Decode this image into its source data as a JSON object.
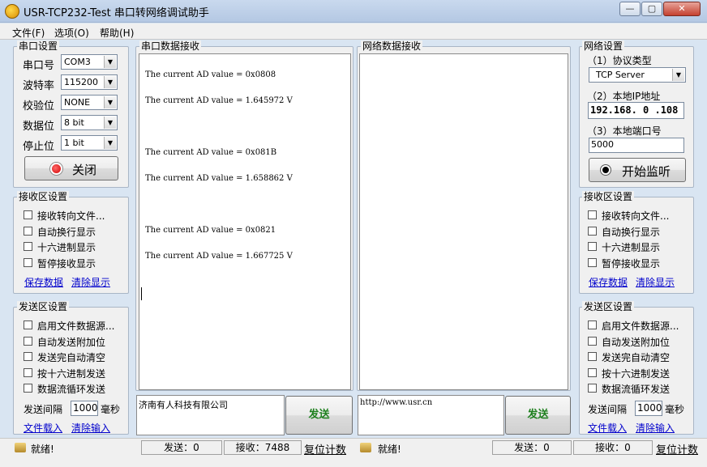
{
  "window": {
    "title": "USR-TCP232-Test 串口转网络调试助手",
    "minimize": "—",
    "maximize": "▢",
    "close": "✕"
  },
  "menu": [
    "文件(F)",
    "选项(O)",
    "帮助(H)"
  ],
  "serial_settings": {
    "title": "串口设置",
    "port_label": "串口号",
    "port_value": "COM3",
    "baud_label": "波特率",
    "baud_value": "115200",
    "parity_label": "校验位",
    "parity_value": "NONE",
    "databits_label": "数据位",
    "databits_value": "8 bit",
    "stopbits_label": "停止位",
    "stopbits_value": "1 bit",
    "close_button": "关闭"
  },
  "left_receive": {
    "title": "接收区设置",
    "options": [
      "接收转向文件...",
      "自动换行显示",
      "十六进制显示",
      "暂停接收显示"
    ],
    "save_link": "保存数据",
    "clear_link": "清除显示"
  },
  "left_send": {
    "title": "发送区设置",
    "options": [
      "启用文件数据源...",
      "自动发送附加位",
      "发送完自动清空",
      "按十六进制发送",
      "数据流循环发送"
    ],
    "interval_label": "发送间隔",
    "interval_value": "1000",
    "interval_unit": "毫秒",
    "load_link": "文件载入",
    "clear_link": "清除输入"
  },
  "serial_receive": {
    "title": "串口数据接收",
    "lines": [
      "The current AD value = 0x0808",
      "The current AD value = 1.645972 V",
      "The current AD value = 0x081B",
      "The current AD value = 1.658862 V",
      "The current AD value = 0x0821",
      "The current AD value = 1.667725 V"
    ]
  },
  "network_receive": {
    "title": "网络数据接收"
  },
  "serial_send": {
    "text": "济南有人科技有限公司",
    "button": "发送"
  },
  "network_send": {
    "text": "http://www.usr.cn",
    "button": "发送"
  },
  "network_settings": {
    "title": "网络设置",
    "protocol_label": "（1）协议类型",
    "protocol_value": "TCP Server",
    "ip_label": "（2）本地IP地址",
    "ip_value": "192.168. 0 .108",
    "port_label": "（3）本地端口号",
    "port_value": "5000",
    "listen_button": "开始监听"
  },
  "right_receive": {
    "title": "接收区设置",
    "options": [
      "接收转向文件...",
      "自动换行显示",
      "十六进制显示",
      "暂停接收显示"
    ],
    "save_link": "保存数据",
    "clear_link": "清除显示"
  },
  "right_send": {
    "title": "发送区设置",
    "options": [
      "启用文件数据源...",
      "自动发送附加位",
      "发送完自动清空",
      "按十六进制发送",
      "数据流循环发送"
    ],
    "interval_label": "发送间隔",
    "interval_value": "1000",
    "interval_unit": "毫秒",
    "load_link": "文件载入",
    "clear_link": "清除输入"
  },
  "status_left": {
    "ready": "就绪!",
    "sent": "发送：0",
    "received": "接收：7488",
    "reset": "复位计数"
  },
  "status_right": {
    "ready": "就绪!",
    "sent": "发送：0",
    "received": "接收：0",
    "reset": "复位计数"
  },
  "colors": {
    "send_text": "#1d7f1d",
    "link": "#0000cc",
    "record_red": "#e00000"
  }
}
